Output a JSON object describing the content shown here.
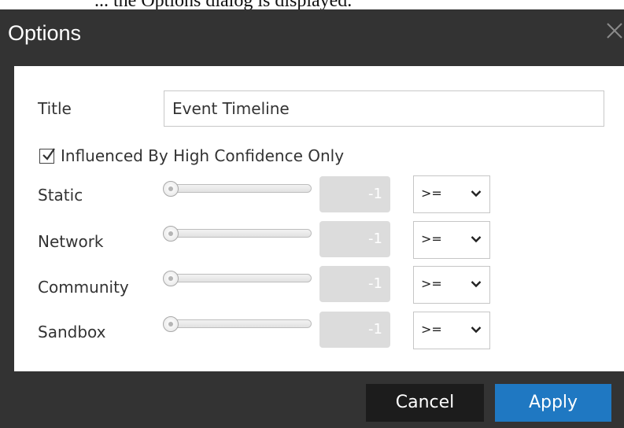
{
  "page_text_fragment": "... the Options dialog is displayed.",
  "dialog": {
    "title": "Options",
    "close_icon": "close-icon"
  },
  "form": {
    "title_label": "Title",
    "title_value": "Event Timeline",
    "high_confidence": {
      "label": "Influenced By High Confidence Only",
      "checked": true
    },
    "rows": [
      {
        "label": "Static",
        "value": "-1",
        "operator": ">="
      },
      {
        "label": "Network",
        "value": "-1",
        "operator": ">="
      },
      {
        "label": "Community",
        "value": "-1",
        "operator": ">="
      },
      {
        "label": "Sandbox",
        "value": "-1",
        "operator": ">="
      }
    ]
  },
  "buttons": {
    "cancel": "Cancel",
    "apply": "Apply"
  },
  "colors": {
    "dialog_frame": "#333333",
    "apply_button": "#1f78c2",
    "cancel_button": "#1c1c1c"
  }
}
